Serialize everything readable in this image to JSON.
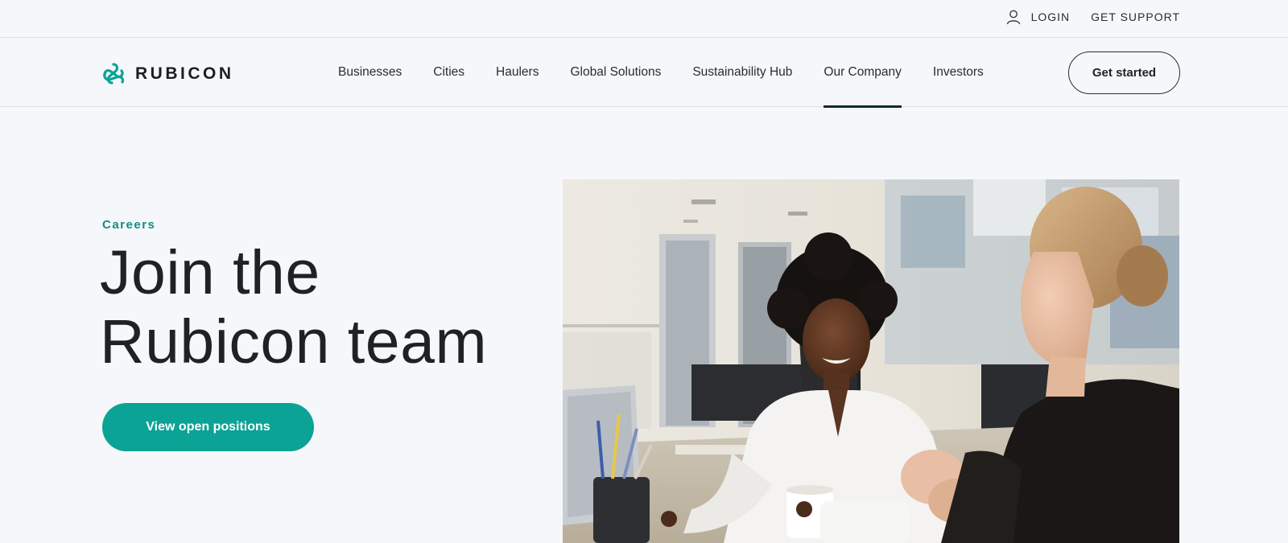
{
  "utility": {
    "login_label": "LOGIN",
    "support_label": "GET SUPPORT"
  },
  "brand": {
    "name": "RUBICON",
    "accent_color": "#0aa396",
    "logo_icon": "rubicon-knot-icon"
  },
  "nav": {
    "items": [
      {
        "label": "Businesses"
      },
      {
        "label": "Cities"
      },
      {
        "label": "Haulers"
      },
      {
        "label": "Global Solutions"
      },
      {
        "label": "Sustainability Hub"
      },
      {
        "label": "Our Company",
        "active": true
      },
      {
        "label": "Investors"
      }
    ],
    "cta_label": "Get started"
  },
  "hero": {
    "eyebrow": "Careers",
    "title_line1": "Join the",
    "title_line2": "Rubicon team",
    "button_label": "View open positions",
    "image": "photo of two women smiling and talking at an office desk"
  }
}
